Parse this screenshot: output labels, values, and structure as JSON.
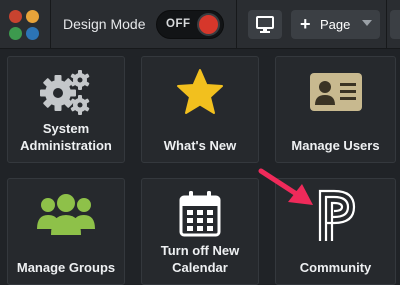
{
  "header": {
    "design_mode_label": "Design Mode",
    "toggle_label": "OFF",
    "page_button_label": "Page",
    "page_button_plus": "+"
  },
  "tiles": [
    {
      "label": "System Administration",
      "icon": "gears-icon"
    },
    {
      "label": "What's New",
      "icon": "star-icon"
    },
    {
      "label": "Manage Users",
      "icon": "id-card-icon"
    },
    {
      "label": "Manage Groups",
      "icon": "users-group-icon"
    },
    {
      "label": "Turn off New Calendar",
      "icon": "calendar-icon"
    },
    {
      "label": "Community",
      "icon": "powerschool-p-icon"
    }
  ],
  "colors": {
    "background": "#202327",
    "topbar": "#2a2d31",
    "tile": "#26292d",
    "toggle_knob": "#d6372b",
    "star": "#f2c01e",
    "group_icon": "#8ec149",
    "arrow": "#ef2a5a"
  }
}
